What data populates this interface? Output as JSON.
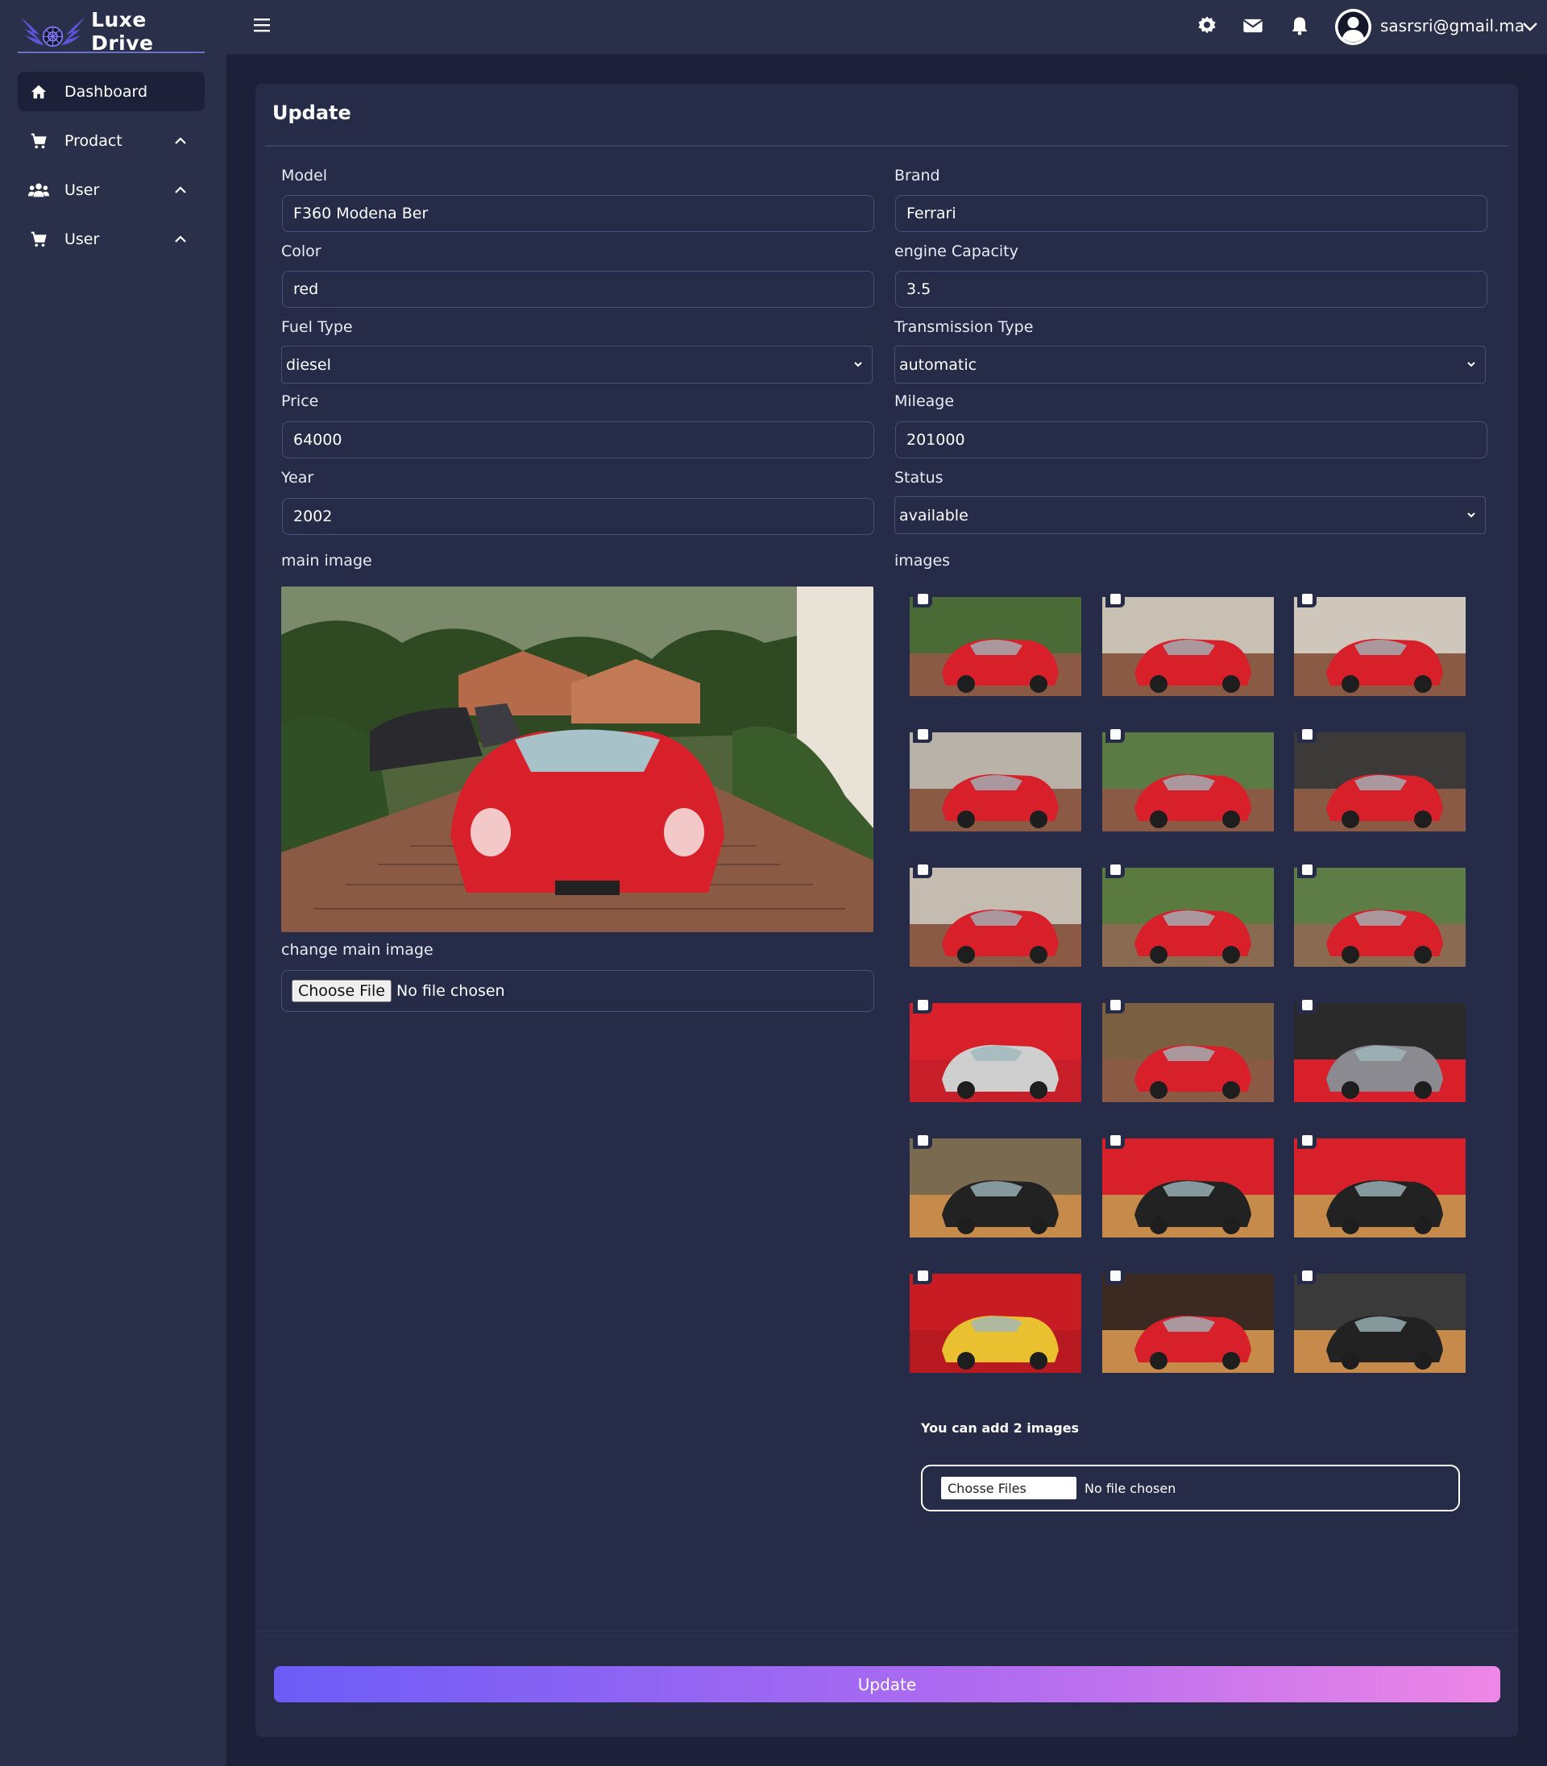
{
  "brand": {
    "name": "Luxe  Drive",
    "logo_icon": "winged-wheel-logo"
  },
  "sidebar": {
    "items": [
      {
        "label": "Dashboard",
        "icon": "home-icon",
        "active": true
      },
      {
        "label": "Prodact",
        "icon": "cart-icon",
        "expandable": true
      },
      {
        "label": "User",
        "icon": "users-icon",
        "expandable": true
      },
      {
        "label": "User",
        "icon": "cart-icon",
        "expandable": true
      }
    ]
  },
  "topbar": {
    "menu_icon": "hamburger-icon",
    "icons": [
      "gear-icon",
      "mail-icon",
      "bell-icon"
    ],
    "user_email": "sasrsri@gmail.ma",
    "user_icon": "user-avatar-icon"
  },
  "form": {
    "title": "Update",
    "model": {
      "label": "Model",
      "value": "F360 Modena Ber"
    },
    "brand": {
      "label": "Brand",
      "value": "Ferrari"
    },
    "color": {
      "label": "Color",
      "value": "red"
    },
    "engine_capacity": {
      "label": "engine Capacity",
      "value": "3.5"
    },
    "fuel_type": {
      "label": "Fuel Type",
      "value": "diesel"
    },
    "transmission_type": {
      "label": "Transmission Type",
      "value": "automatic"
    },
    "price": {
      "label": "Price",
      "value": "64000"
    },
    "mileage": {
      "label": "Mileage",
      "value": "201000"
    },
    "year": {
      "label": "Year",
      "value": "2002"
    },
    "status": {
      "label": "Status",
      "value": "available"
    },
    "main_image_label": "main image",
    "change_main_image_label": "change main image",
    "main_file": {
      "button": "Choose File",
      "status": "No file chosen"
    },
    "images_label": "images",
    "thumbnail_count": 18,
    "add_hint": "You can add 2 images",
    "multi_file": {
      "button": "Chosse Files",
      "status": "No file chosen"
    },
    "submit_label": "Update"
  },
  "colors": {
    "background": "#1c2039",
    "panel": "#2a2f4a",
    "card": "#262b48",
    "button_gradient_start": "#6c5cf6",
    "button_gradient_end": "#ee86e6",
    "car_red": "#d8202a"
  }
}
